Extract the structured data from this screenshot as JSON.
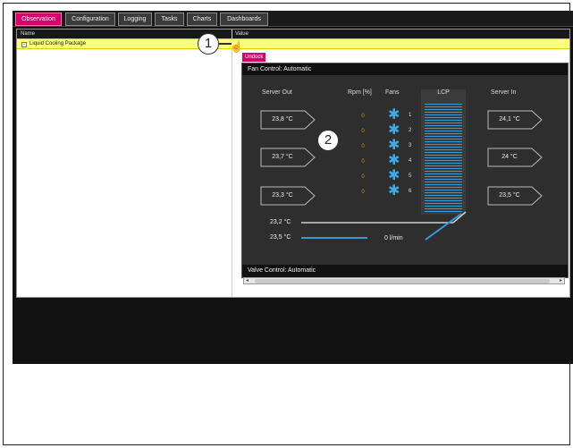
{
  "tabs": [
    {
      "label": "Observation",
      "active": true
    },
    {
      "label": "Configuration",
      "active": false
    },
    {
      "label": "Logging",
      "active": false
    },
    {
      "label": "Tasks",
      "active": false
    },
    {
      "label": "Charts",
      "active": false
    },
    {
      "label": "Dashboards",
      "active": false
    }
  ],
  "table": {
    "col_name": "Name",
    "col_value": "Value",
    "row_toggle": "−",
    "row_label": "Liquid Cooling Package"
  },
  "callouts": {
    "one": "1",
    "two": "2"
  },
  "undock_label": "Undock",
  "fan_control": "Fan Control:  Automatic",
  "valve_control": "Valve Control:  Automatic",
  "columns": {
    "server_out": "Server Out",
    "rpm": "Rpm [%]",
    "fans": "Fans",
    "lcp": "LCP",
    "server_in": "Server In"
  },
  "server_out": [
    "23,8 °C",
    "23,7 °C",
    "23,3 °C"
  ],
  "server_in": [
    "24,1 °C",
    "24 °C",
    "23,5 °C"
  ],
  "rpm": [
    "0",
    "0",
    "0",
    "0",
    "0",
    "0"
  ],
  "fan_numbers": [
    "1",
    "2",
    "3",
    "4",
    "5",
    "6"
  ],
  "water": {
    "return_temp": "23,2 °C",
    "supply_temp": "23,5 °C",
    "flow": "0 l/min"
  },
  "colors": {
    "accent": "#d8006b",
    "fan_blue": "#3fa9e6",
    "rpm_orange": "#e58b1e",
    "row_highlight": "#fbff7a"
  }
}
